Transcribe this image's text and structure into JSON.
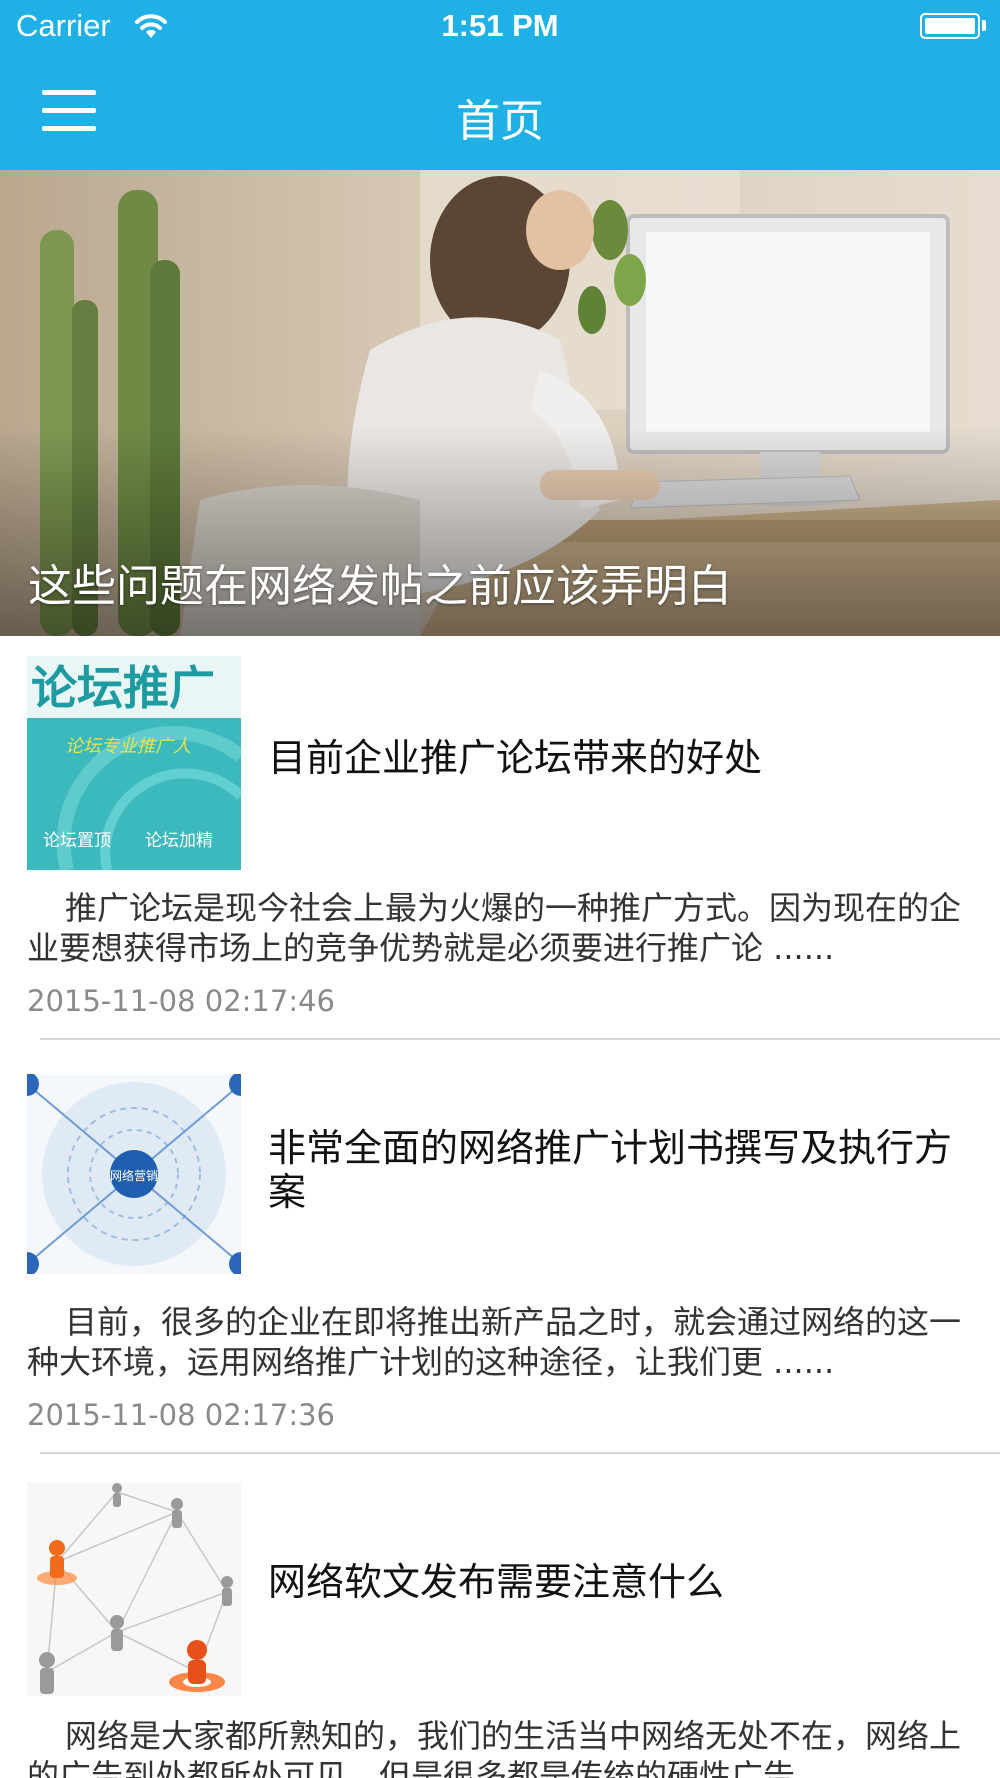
{
  "status_bar": {
    "carrier": "Carrier",
    "time": "1:51 PM"
  },
  "nav_bar": {
    "title": "首页",
    "menu_icon": "hamburger-menu-icon",
    "background_color": "#1fb0e6"
  },
  "banner": {
    "caption": "这些问题在网络发帖之前应该弄明白"
  },
  "articles": [
    {
      "title": "目前企业推广论坛带来的好处",
      "summary": "推广论坛是现今社会上最为火爆的一种推广方式。因为现在的企业要想获得市场上的竞争优势就是必须要进行推广论 ......",
      "time": "2015-11-08 02:17:46",
      "thumb_text": {
        "headline": "论坛推广",
        "slogan": "论坛专业推广人",
        "tag1": "论坛置顶",
        "tag2": "论坛加精"
      }
    },
    {
      "title": "非常全面的网络推广计划书撰写及执行方案",
      "summary": "目前，很多的企业在即将推出新产品之时，就会通过网络的这一种大环境，运用网络推广计划的这种途径，让我们更 ......",
      "time": "2015-11-08 02:17:36",
      "thumb_text": {
        "center": "网络营销"
      }
    },
    {
      "title": "网络软文发布需要注意什么",
      "summary": "网络是大家都所熟知的，我们的生活当中网络无处不在，网络上的广告到处都所处可见，但是很多都是传统的硬性广告"
    }
  ]
}
